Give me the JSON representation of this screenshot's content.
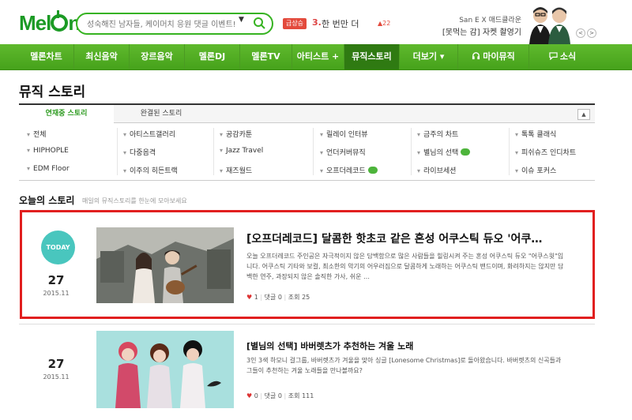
{
  "header": {
    "logo": "Mel",
    "logo_tail": "n",
    "search_placeholder": "성숙해진 남자들, 케이머치 응원 댓글 이벤트!!",
    "search_dropdown": "▼",
    "rank_badge": "급상승",
    "rank_number": "3.",
    "rank_title": "한 번만 더",
    "rank_change": "▲22",
    "promo_sub": "San E X 매드클라운",
    "promo_title": "[못먹는 감] 자켓 촬영기",
    "prev": "<",
    "next": ">"
  },
  "gnb": {
    "items": [
      "멜론차트",
      "최신음악",
      "장르음악",
      "멜론DJ",
      "멜론TV",
      "아티스트 +",
      "뮤직스토리",
      "더보기 ▾",
      "마이뮤직",
      "소식"
    ],
    "active_index": 6
  },
  "page": {
    "title": "뮤직 스토리",
    "tabs": [
      "연재중 스토리",
      "완결된 스토리"
    ],
    "active_tab": 0,
    "tab_toggle": "▲"
  },
  "categories": [
    [
      "전체",
      "아티스트갤러리",
      "공감카툰",
      "릴레이 인터뷰",
      "금주의 차트",
      "톡톡 클래식"
    ],
    [
      "HIPHOPLE",
      "다중음격",
      "Jazz Travel",
      "언더커버뮤직",
      "별님의 선택",
      "피쉬슈즈 인디차트"
    ],
    [
      "EDM Floor",
      "이주의 히든트랙",
      "재즈월드",
      "오프더레코드",
      "라이브세션",
      "이슈 포커스"
    ]
  ],
  "today": {
    "heading": "오늘의 스토리",
    "sub": "매일의 뮤직스토리를 한눈에 모아보세요",
    "badge": "TODAY"
  },
  "stories": [
    {
      "day": "27",
      "ym": "2015.11",
      "title": "[오프더레코드] 달콤한 핫초코 같은 혼성 어쿠스틱 듀오 '어쿠…",
      "desc": "오늘 오프더레코드 주인공은 자극적이지 않은 담백함으로 많은 사람들을 힐링시켜 주는 혼성 어쿠스틱 듀오 \"어쿠스윗\"입니다. 어쿠스틱 기타와 보컬, 최소한의 악기의 어우러짐으로 달콤하게 노래하는 어쿠스틱 밴드이며, 화려하지는 않지만 담백한 연주, 과장되지 않은 솔직한 가사, 쉬운 …",
      "likes": "1",
      "comments_label": "댓글",
      "comments": "0",
      "views_label": "조회",
      "views": "25"
    },
    {
      "day": "27",
      "ym": "2015.11",
      "title": "[별님의 선택] 바버렛츠가 추천하는 겨울 노래",
      "desc": "3인 3색 하모니 걸그룹, 바버렛츠가 겨울을 맞아 싱글 [Lonesome Christmas]로 돌아왔습니다. 바버렛츠의 신곡들과 그들이 추천하는 겨울 노래들을 만나볼까요?",
      "likes": "0",
      "comments_label": "댓글",
      "comments": "0",
      "views_label": "조회",
      "views": "111"
    }
  ],
  "colors": {
    "brand": "#46a21b",
    "highlight": "#e11f1f",
    "today": "#49c6be"
  }
}
